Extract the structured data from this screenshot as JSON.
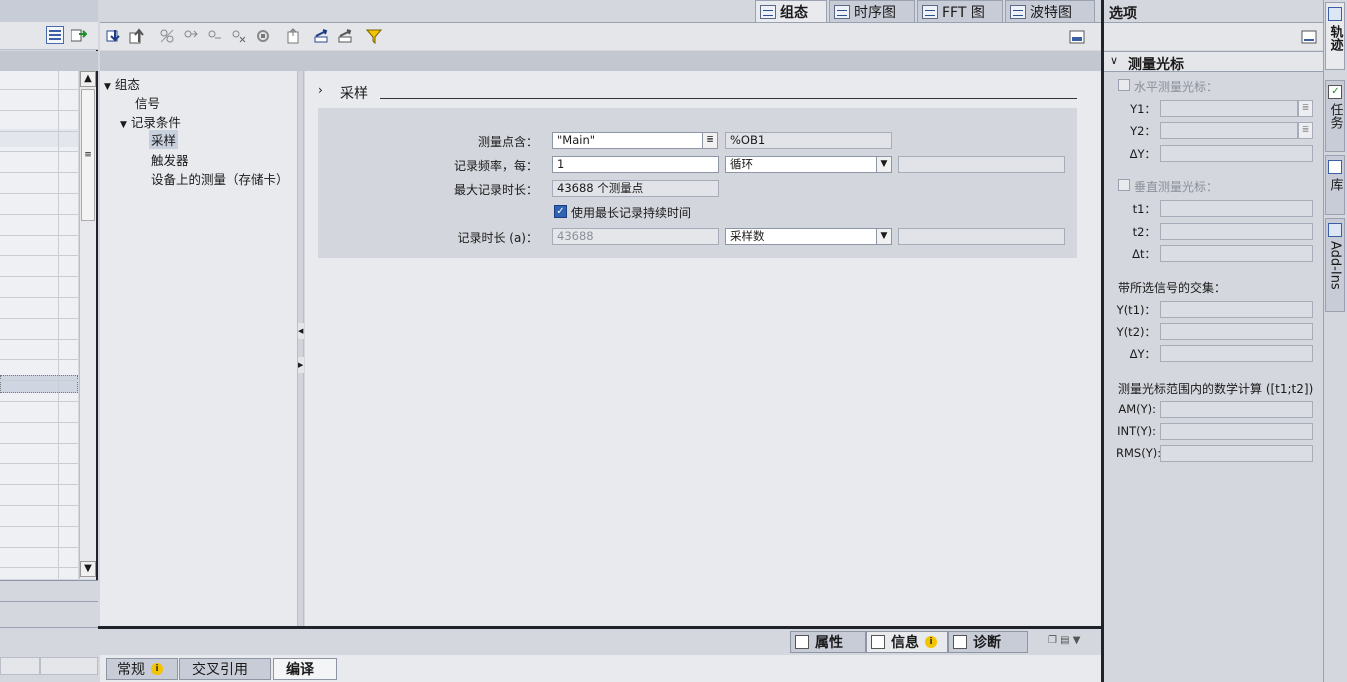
{
  "top_tabs": [
    {
      "label": "组态",
      "active": true
    },
    {
      "label": "时序图",
      "active": false
    },
    {
      "label": "FFT 图",
      "active": false
    },
    {
      "label": "波特图",
      "active": false
    }
  ],
  "tree": {
    "root": "组态",
    "signals": "信号",
    "record_conditions": "记录条件",
    "sampling": "采样",
    "trigger": "触发器",
    "device_measure": "设备上的测量（存储卡）"
  },
  "section": {
    "title": "采样",
    "chevron": "›"
  },
  "form": {
    "measure_point_label": "测量点含：",
    "measure_point_value": "\"Main\"",
    "measure_point_ob": "%OB1",
    "record_freq_label": "记录频率，每：",
    "record_freq_value": "1",
    "record_freq_unit": "循环",
    "max_duration_label": "最大记录时长：",
    "max_duration_value": "43688 个测量点",
    "use_max_label": "使用最长记录持续时间",
    "use_max_checked": true,
    "duration_label": "记录时长 (a)：",
    "duration_value": "43688",
    "duration_unit": "采样数"
  },
  "options": {
    "title": "选项",
    "cursor_section": "测量光标",
    "horizontal": "水平测量光标：",
    "y1": "Y1：",
    "y2": "Y2：",
    "dy": "ΔY：",
    "vertical": "垂直测量光标：",
    "t1": "t1：",
    "t2": "t2：",
    "dt": "Δt：",
    "intersect": "带所选信号的交集：",
    "yt1": "Y(t1)：",
    "yt2": "Y(t2)：",
    "dy2": "ΔY：",
    "math": "测量光标范围内的数学计算 ([t1;t2])",
    "am": "AM(Y):",
    "int": "INT(Y):",
    "rms": "RMS(Y):"
  },
  "right_tabs": [
    "轨迹",
    "任务",
    "库",
    "Add-Ins"
  ],
  "inspector_tabs": {
    "properties": "属性",
    "info": "信息",
    "diagnostics": "诊断"
  },
  "bottom_tabs": {
    "general": "常规",
    "cross_ref": "交叉引用",
    "compile": "编译"
  }
}
